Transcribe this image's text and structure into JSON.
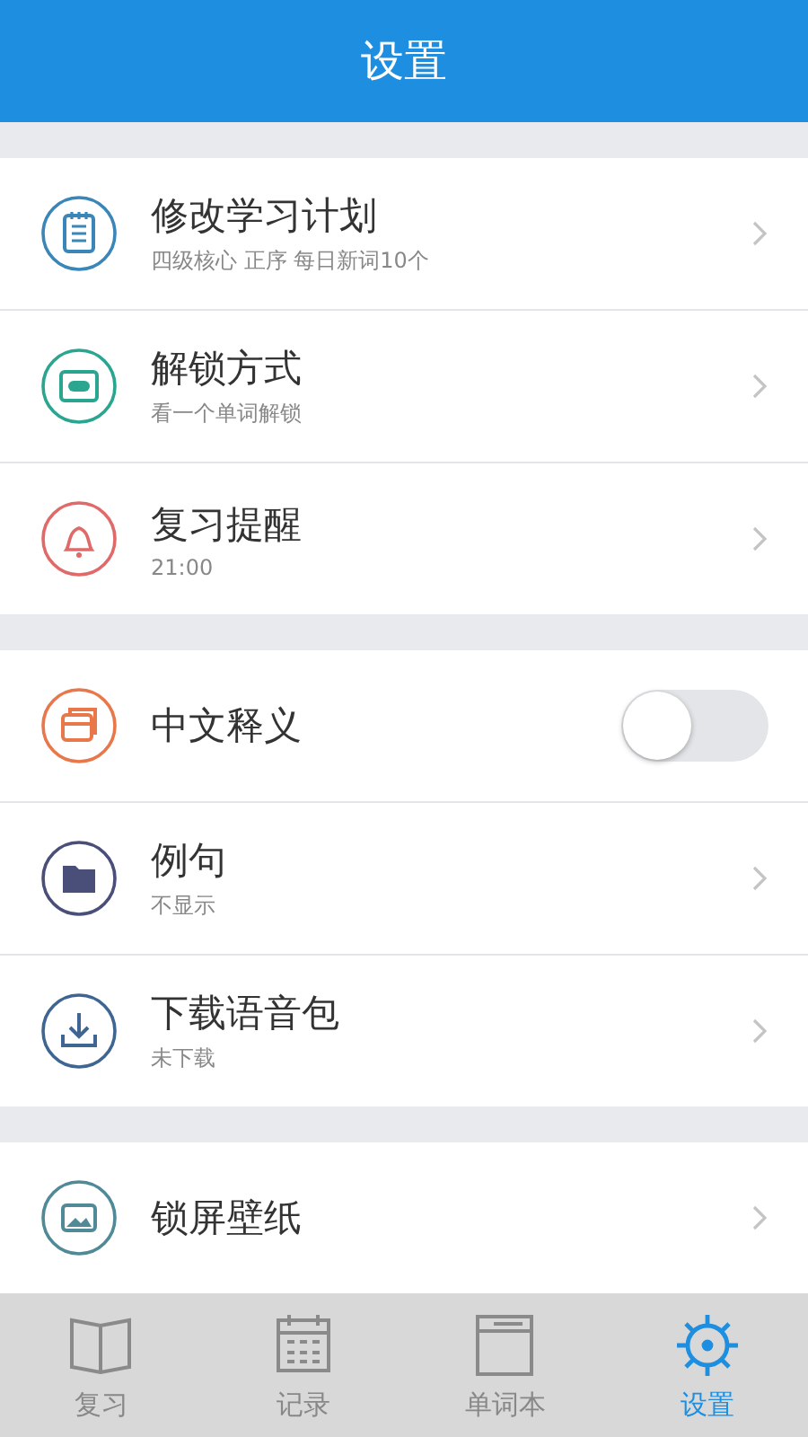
{
  "header": {
    "title": "设置"
  },
  "sections": [
    {
      "items": [
        {
          "kind": "link",
          "title": "修改学习计划",
          "subtitle": "四级核心 正序 每日新词10个",
          "color": "#3a86b8"
        },
        {
          "kind": "link",
          "title": "解锁方式",
          "subtitle": "看一个单词解锁",
          "color": "#2aa58f"
        },
        {
          "kind": "link",
          "title": "复习提醒",
          "subtitle": "21:00",
          "color": "#e06a6a"
        }
      ]
    },
    {
      "items": [
        {
          "kind": "toggle",
          "title": "中文释义",
          "on": false,
          "color": "#e8774a"
        },
        {
          "kind": "link",
          "title": "例句",
          "subtitle": "不显示",
          "color": "#4a4f7a"
        },
        {
          "kind": "link",
          "title": "下载语音包",
          "subtitle": "未下载",
          "color": "#3f6592"
        }
      ]
    },
    {
      "items": [
        {
          "kind": "link",
          "title": "锁屏壁纸",
          "color": "#4f8a96"
        }
      ]
    }
  ],
  "tabs": [
    {
      "label": "复习",
      "selected": false
    },
    {
      "label": "记录",
      "selected": false
    },
    {
      "label": "单词本",
      "selected": false
    },
    {
      "label": "设置",
      "selected": true
    }
  ]
}
